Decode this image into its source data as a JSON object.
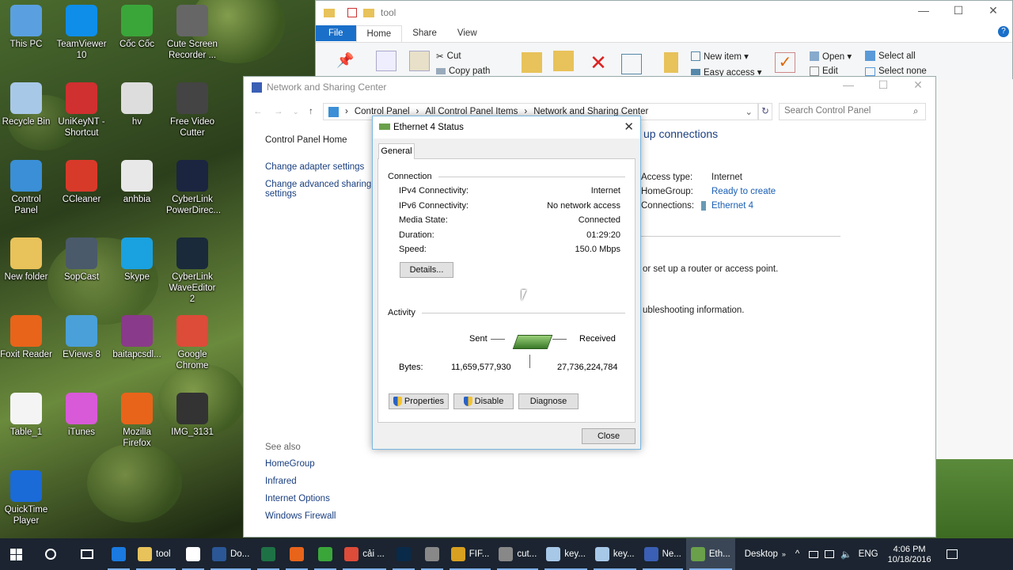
{
  "desktop_icons": [
    {
      "label": "This PC",
      "icon": "computer-icon",
      "color": "#5aa0e0"
    },
    {
      "label": "TeamViewer 10",
      "icon": "teamviewer-icon",
      "color": "#0e8ee9"
    },
    {
      "label": "Cốc Cốc",
      "icon": "coccoc-icon",
      "color": "#3aa63a"
    },
    {
      "label": "Cute Screen Recorder ...",
      "icon": "film-reel-icon",
      "color": "#666666"
    },
    {
      "label": "Recycle Bin",
      "icon": "recycle-bin-icon",
      "color": "#a8c8e8"
    },
    {
      "label": "UniKeyNT - Shortcut",
      "icon": "unikey-icon",
      "color": "#d03030"
    },
    {
      "label": "hv",
      "icon": "folder-icon",
      "color": "#dddddd"
    },
    {
      "label": "Free Video Cutter",
      "icon": "film-reel-icon",
      "color": "#444444"
    },
    {
      "label": "Control Panel",
      "icon": "control-panel-icon",
      "color": "#3a8fd6"
    },
    {
      "label": "CCleaner",
      "icon": "ccleaner-icon",
      "color": "#d83a2a"
    },
    {
      "label": "anhbia",
      "icon": "image-file-icon",
      "color": "#e8e8e8"
    },
    {
      "label": "CyberLink PowerDirec...",
      "icon": "powerdirector-icon",
      "color": "#1b2540"
    },
    {
      "label": "New folder",
      "icon": "folder-icon",
      "color": "#e8c25a"
    },
    {
      "label": "SopCast",
      "icon": "sopcast-icon",
      "color": "#4a5a6a"
    },
    {
      "label": "Skype",
      "icon": "skype-icon",
      "color": "#1aa1e0"
    },
    {
      "label": "CyberLink WaveEditor 2",
      "icon": "waveeditor-icon",
      "color": "#1a2a3a"
    },
    {
      "label": "Foxit Reader",
      "icon": "foxit-icon",
      "color": "#e8641a"
    },
    {
      "label": "EViews 8",
      "icon": "eviews-icon",
      "color": "#4aa0d8"
    },
    {
      "label": "baitapcsdl...",
      "icon": "winrar-icon",
      "color": "#8a3a8a"
    },
    {
      "label": "Google Chrome",
      "icon": "chrome-icon",
      "color": "#dd4b39"
    },
    {
      "label": "Table_1",
      "icon": "document-icon",
      "color": "#f4f4f4"
    },
    {
      "label": "iTunes",
      "icon": "itunes-icon",
      "color": "#d85ad8"
    },
    {
      "label": "Mozilla Firefox",
      "icon": "firefox-icon",
      "color": "#e8641a"
    },
    {
      "label": "IMG_3131",
      "icon": "video-file-icon",
      "color": "#333333"
    },
    {
      "label": "QuickTime Player",
      "icon": "quicktime-icon",
      "color": "#1a6ad8"
    }
  ],
  "explorer": {
    "title": "tool",
    "tabs": [
      "File",
      "Home",
      "Share",
      "View"
    ],
    "ribbon": {
      "cut": "Cut",
      "copy_path": "Copy path",
      "new_item": "New item ▾",
      "easy_access": "Easy access ▾",
      "open": "Open ▾",
      "edit": "Edit",
      "select_all": "Select all",
      "select_none": "Select none"
    }
  },
  "nsc": {
    "title": "Network and Sharing Center",
    "breadcrumb": [
      "Control Panel",
      "All Control Panel Items",
      "Network and Sharing Center"
    ],
    "search_placeholder": "Search Control Panel",
    "left_links": [
      "Control Panel Home",
      "Change adapter settings",
      "Change advanced sharing settings"
    ],
    "see_also_label": "See also",
    "see_also": [
      "HomeGroup",
      "Infrared",
      "Internet Options",
      "Windows Firewall"
    ],
    "heading_fragment": "up connections",
    "access_type_label": "Access type:",
    "access_type_value": "Internet",
    "homegroup_label": "HomeGroup:",
    "homegroup_value": "Ready to create",
    "connections_label": "Connections:",
    "connections_value": "Ethernet 4",
    "text1": "or set up a router or access point.",
    "text2": "ubleshooting information."
  },
  "dialog": {
    "title": "Ethernet 4 Status",
    "tab": "General",
    "connection_label": "Connection",
    "rows": [
      {
        "label": "IPv4 Connectivity:",
        "value": "Internet"
      },
      {
        "label": "IPv6 Connectivity:",
        "value": "No network access"
      },
      {
        "label": "Media State:",
        "value": "Connected"
      },
      {
        "label": "Duration:",
        "value": "01:29:20"
      },
      {
        "label": "Speed:",
        "value": "150.0 Mbps"
      }
    ],
    "details_button": "Details...",
    "activity_label": "Activity",
    "sent_label": "Sent",
    "received_label": "Received",
    "bytes_label": "Bytes:",
    "bytes_sent": "11,659,577,930",
    "bytes_received": "27,736,224,784",
    "properties_button": "Properties",
    "disable_button": "Disable",
    "diagnose_button": "Diagnose",
    "close_button": "Close"
  },
  "taskbar": {
    "items": [
      {
        "label": "",
        "icon": "edge-icon",
        "color": "#1a7ae0"
      },
      {
        "label": "tool",
        "icon": "folder-icon",
        "color": "#e8c25a"
      },
      {
        "label": "",
        "icon": "store-icon",
        "color": "#ffffff"
      },
      {
        "label": "Do...",
        "icon": "word-icon",
        "color": "#2b5797"
      },
      {
        "label": "",
        "icon": "excel-icon",
        "color": "#1e7145"
      },
      {
        "label": "",
        "icon": "firefox-icon",
        "color": "#e8641a"
      },
      {
        "label": "",
        "icon": "coccoc-icon",
        "color": "#3aa63a"
      },
      {
        "label": "cải ...",
        "icon": "chrome-icon",
        "color": "#dd4b39"
      },
      {
        "label": "",
        "icon": "photoshop-icon",
        "color": "#0a2a4a"
      },
      {
        "label": "",
        "icon": "tools-icon",
        "color": "#888888"
      },
      {
        "label": "FIF...",
        "icon": "fifa-icon",
        "color": "#d8a020"
      },
      {
        "label": "cut...",
        "icon": "film-reel-icon",
        "color": "#888888"
      },
      {
        "label": "key...",
        "icon": "key-icon",
        "color": "#a8c8e8"
      },
      {
        "label": "key...",
        "icon": "key-icon",
        "color": "#a8c8e8"
      },
      {
        "label": "Ne...",
        "icon": "network-center-icon",
        "color": "#3a5fb4"
      },
      {
        "label": "Eth...",
        "icon": "ethernet-icon",
        "color": "#6aa04a"
      }
    ],
    "desktop_label": "Desktop",
    "lang": "ENG",
    "time": "4:06 PM",
    "date": "10/18/2016"
  }
}
